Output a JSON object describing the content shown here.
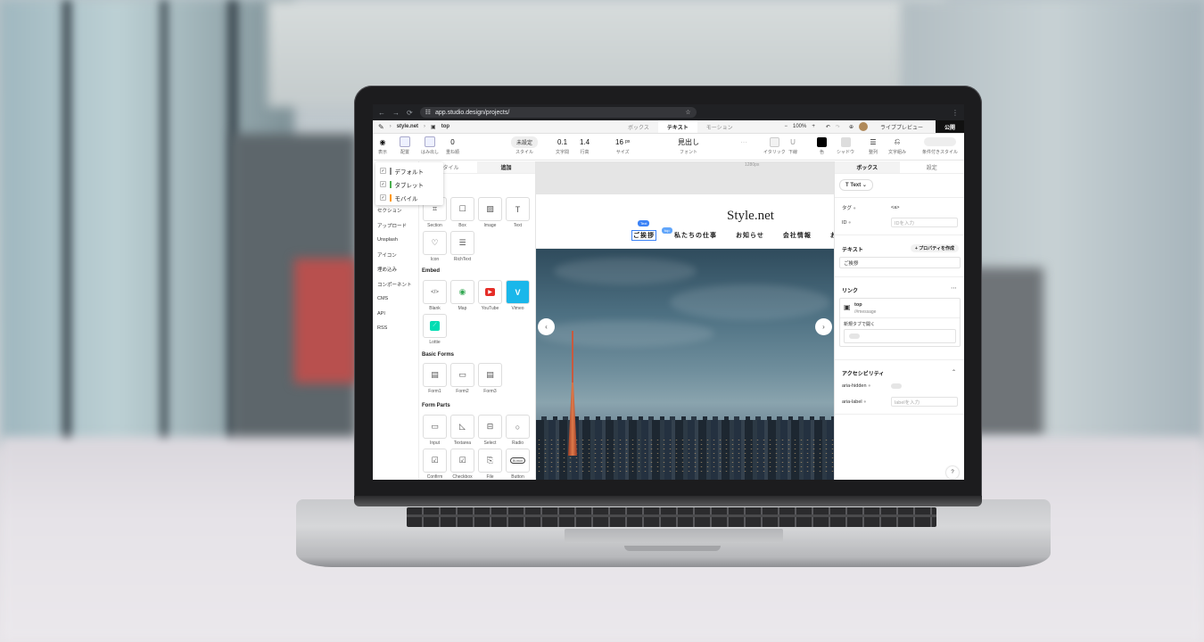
{
  "browser": {
    "url": "app.studio.design/projects/"
  },
  "studio": {
    "breadcrumb_site": "style.net",
    "breadcrumb_page": "top",
    "tabs": [
      "ボックス",
      "テキスト",
      "モーション"
    ],
    "zoom": "100%",
    "preview": "ライブプレビュー",
    "publish": "公開"
  },
  "toolbar": {
    "display": "表示",
    "layout": "配置",
    "overflow": "はみ出し",
    "stack_value": "0",
    "stack": "重ね順",
    "style_btn": "未設定",
    "style": "スタイル",
    "letter_spacing_value": "0.1",
    "letter_spacing": "文字間",
    "line_height_value": "1.4",
    "line_height": "行高",
    "size_value": "16",
    "size_unit": "px",
    "size": "サイズ",
    "font_value": "見出し",
    "font": "フォント",
    "italic": "イタリック",
    "underline": "下線",
    "color": "色",
    "shadow": "シャドウ",
    "align": "整列",
    "wrap": "文字組み",
    "conditional": "条件付きスタイル"
  },
  "device_menu": [
    "デフォルト",
    "タブレット",
    "モバイル"
  ],
  "device_colors": [
    "#888888",
    "#4caf50",
    "#ff9800"
  ],
  "left_rail": [
    "セクション",
    "アップロード",
    "Unsplash",
    "アイコン",
    "埋め込み",
    "コンポーネント",
    "CMS",
    "API",
    "RSS"
  ],
  "left_panel": {
    "tabs": [
      "スタイル",
      "追加"
    ],
    "basic": [
      {
        "label": "Section",
        "glyph": "⌗"
      },
      {
        "label": "Box",
        "glyph": "☐"
      },
      {
        "label": "Image",
        "glyph": "▨"
      },
      {
        "label": "Text",
        "glyph": "T"
      },
      {
        "label": "Icon",
        "glyph": "♡"
      },
      {
        "label": "RichText",
        "glyph": "☰"
      }
    ],
    "embed_title": "Embed",
    "embed": [
      {
        "label": "Blank",
        "glyph": "</>"
      },
      {
        "label": "Map",
        "glyph": "◉"
      },
      {
        "label": "YouTube",
        "glyph": "▶"
      },
      {
        "label": "Vimeo",
        "glyph": "V"
      },
      {
        "label": "Lottie",
        "glyph": "⟋"
      }
    ],
    "forms_title": "Basic Forms",
    "forms": [
      {
        "label": "Form1",
        "glyph": "▤"
      },
      {
        "label": "Form2",
        "glyph": "▭"
      },
      {
        "label": "Form3",
        "glyph": "▤"
      }
    ],
    "parts_title": "Form Parts",
    "parts": [
      {
        "label": "Input",
        "glyph": "▭"
      },
      {
        "label": "Textarea",
        "glyph": "◺"
      },
      {
        "label": "Select",
        "glyph": "⊟"
      },
      {
        "label": "Radio",
        "glyph": "○"
      },
      {
        "label": "Confirm",
        "glyph": "☑"
      },
      {
        "label": "Checkbox",
        "glyph": "☑"
      },
      {
        "label": "File",
        "glyph": "⎘"
      },
      {
        "label": "Button",
        "glyph": "Button"
      }
    ]
  },
  "canvas": {
    "width_label": "1280px",
    "site_title": "Style.net",
    "nav": [
      "ご挨拶",
      "私たちの仕事",
      "お知らせ",
      "会社情報",
      "お"
    ],
    "badge_top": "Text",
    "badge_link": "top"
  },
  "right_panel": {
    "tabs": [
      "ボックス",
      "設定"
    ],
    "type_chip": "Text",
    "tag_label": "タグ",
    "tag_value": "<a>",
    "id_label": "ID",
    "id_placeholder": "IDを入力",
    "text_label": "テキスト",
    "text_prop_btn": "+ プロパティを作成",
    "text_value": "ご挨拶",
    "link_label": "リンク",
    "link_page": "top",
    "link_path": "/#message",
    "new_tab": "新規タブで開く",
    "a11y_label": "アクセシビリティ",
    "aria_hidden": "aria-hidden",
    "aria_label": "aria-label",
    "aria_label_placeholder": "labelを入力"
  }
}
